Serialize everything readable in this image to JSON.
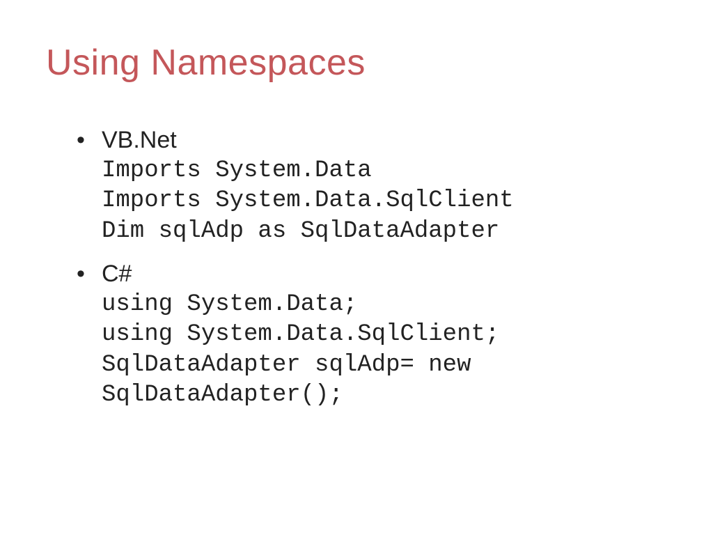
{
  "title": "Using Namespaces",
  "bullets": [
    {
      "label": "VB.Net",
      "code": "Imports System.Data\nImports System.Data.SqlClient\nDim sqlAdp as SqlDataAdapter"
    },
    {
      "label": "C#",
      "code": "using System.Data;\nusing System.Data.SqlClient;\nSqlDataAdapter sqlAdp= new SqlDataAdapter();"
    }
  ]
}
